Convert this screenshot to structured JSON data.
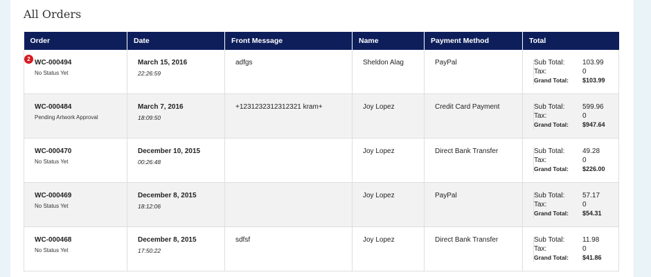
{
  "page": {
    "title": "All Orders"
  },
  "table": {
    "headers": [
      "Order",
      "Date",
      "Front Message",
      "Name",
      "Payment Method",
      "Total"
    ],
    "labels": {
      "sub_total": "Sub Total:",
      "tax": "Tax:",
      "grand_total": "Grand Total:"
    },
    "rows": [
      {
        "order_id": "WC-000494",
        "status": "No Status Yet",
        "badge": "2",
        "date": "March 15, 2016",
        "time": "22:26:59",
        "message": "adfgs",
        "name": "Sheldon Alag",
        "payment": "PayPal",
        "sub_total": "103.99",
        "tax": "0",
        "grand_total": "$103.99"
      },
      {
        "order_id": "WC-000484",
        "status": "Pending Artwork Approval",
        "date": "March 7, 2016",
        "time": "18:09:50",
        "message": "+1231232312312321 kram+",
        "name": "Joy Lopez",
        "payment": "Credit Card Payment",
        "sub_total": "599.96",
        "tax": "0",
        "grand_total": "$947.64"
      },
      {
        "order_id": "WC-000470",
        "status": "No Status Yet",
        "date": "December 10, 2015",
        "time": "00:26:48",
        "message": "",
        "name": "Joy Lopez",
        "payment": "Direct Bank Transfer",
        "sub_total": "49.28",
        "tax": "0",
        "grand_total": "$226.00"
      },
      {
        "order_id": "WC-000469",
        "status": "No Status Yet",
        "date": "December 8, 2015",
        "time": "18:12:06",
        "message": "",
        "name": "Joy Lopez",
        "payment": "PayPal",
        "sub_total": "57.17",
        "tax": "0",
        "grand_total": "$54.31"
      },
      {
        "order_id": "WC-000468",
        "status": "No Status Yet",
        "date": "December 8, 2015",
        "time": "17:50:22",
        "message": "sdfsf",
        "name": "Joy Lopez",
        "payment": "Direct Bank Transfer",
        "sub_total": "11.98",
        "tax": "0",
        "grand_total": "$41.86"
      }
    ]
  },
  "colors": {
    "header_bg": "#0e1e5b",
    "page_bg": "#e9f3f8",
    "badge": "#d71920",
    "alt_row": "#f2f2f2"
  }
}
